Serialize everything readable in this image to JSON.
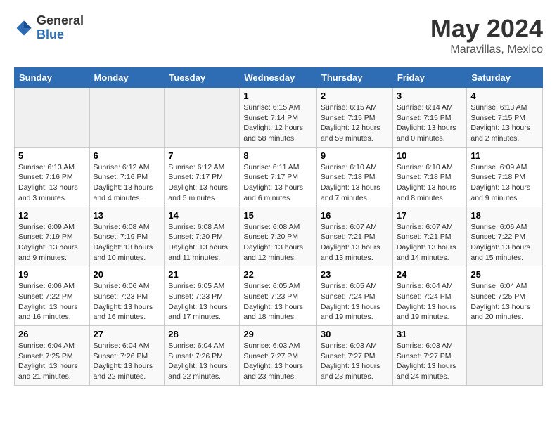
{
  "logo": {
    "general": "General",
    "blue": "Blue"
  },
  "title": {
    "month": "May 2024",
    "location": "Maravillas, Mexico"
  },
  "headers": [
    "Sunday",
    "Monday",
    "Tuesday",
    "Wednesday",
    "Thursday",
    "Friday",
    "Saturday"
  ],
  "weeks": [
    [
      {
        "day": "",
        "sunrise": "",
        "sunset": "",
        "daylight": ""
      },
      {
        "day": "",
        "sunrise": "",
        "sunset": "",
        "daylight": ""
      },
      {
        "day": "",
        "sunrise": "",
        "sunset": "",
        "daylight": ""
      },
      {
        "day": "1",
        "sunrise": "Sunrise: 6:15 AM",
        "sunset": "Sunset: 7:14 PM",
        "daylight": "Daylight: 12 hours and 58 minutes."
      },
      {
        "day": "2",
        "sunrise": "Sunrise: 6:15 AM",
        "sunset": "Sunset: 7:15 PM",
        "daylight": "Daylight: 12 hours and 59 minutes."
      },
      {
        "day": "3",
        "sunrise": "Sunrise: 6:14 AM",
        "sunset": "Sunset: 7:15 PM",
        "daylight": "Daylight: 13 hours and 0 minutes."
      },
      {
        "day": "4",
        "sunrise": "Sunrise: 6:13 AM",
        "sunset": "Sunset: 7:15 PM",
        "daylight": "Daylight: 13 hours and 2 minutes."
      }
    ],
    [
      {
        "day": "5",
        "sunrise": "Sunrise: 6:13 AM",
        "sunset": "Sunset: 7:16 PM",
        "daylight": "Daylight: 13 hours and 3 minutes."
      },
      {
        "day": "6",
        "sunrise": "Sunrise: 6:12 AM",
        "sunset": "Sunset: 7:16 PM",
        "daylight": "Daylight: 13 hours and 4 minutes."
      },
      {
        "day": "7",
        "sunrise": "Sunrise: 6:12 AM",
        "sunset": "Sunset: 7:17 PM",
        "daylight": "Daylight: 13 hours and 5 minutes."
      },
      {
        "day": "8",
        "sunrise": "Sunrise: 6:11 AM",
        "sunset": "Sunset: 7:17 PM",
        "daylight": "Daylight: 13 hours and 6 minutes."
      },
      {
        "day": "9",
        "sunrise": "Sunrise: 6:10 AM",
        "sunset": "Sunset: 7:18 PM",
        "daylight": "Daylight: 13 hours and 7 minutes."
      },
      {
        "day": "10",
        "sunrise": "Sunrise: 6:10 AM",
        "sunset": "Sunset: 7:18 PM",
        "daylight": "Daylight: 13 hours and 8 minutes."
      },
      {
        "day": "11",
        "sunrise": "Sunrise: 6:09 AM",
        "sunset": "Sunset: 7:18 PM",
        "daylight": "Daylight: 13 hours and 9 minutes."
      }
    ],
    [
      {
        "day": "12",
        "sunrise": "Sunrise: 6:09 AM",
        "sunset": "Sunset: 7:19 PM",
        "daylight": "Daylight: 13 hours and 9 minutes."
      },
      {
        "day": "13",
        "sunrise": "Sunrise: 6:08 AM",
        "sunset": "Sunset: 7:19 PM",
        "daylight": "Daylight: 13 hours and 10 minutes."
      },
      {
        "day": "14",
        "sunrise": "Sunrise: 6:08 AM",
        "sunset": "Sunset: 7:20 PM",
        "daylight": "Daylight: 13 hours and 11 minutes."
      },
      {
        "day": "15",
        "sunrise": "Sunrise: 6:08 AM",
        "sunset": "Sunset: 7:20 PM",
        "daylight": "Daylight: 13 hours and 12 minutes."
      },
      {
        "day": "16",
        "sunrise": "Sunrise: 6:07 AM",
        "sunset": "Sunset: 7:21 PM",
        "daylight": "Daylight: 13 hours and 13 minutes."
      },
      {
        "day": "17",
        "sunrise": "Sunrise: 6:07 AM",
        "sunset": "Sunset: 7:21 PM",
        "daylight": "Daylight: 13 hours and 14 minutes."
      },
      {
        "day": "18",
        "sunrise": "Sunrise: 6:06 AM",
        "sunset": "Sunset: 7:22 PM",
        "daylight": "Daylight: 13 hours and 15 minutes."
      }
    ],
    [
      {
        "day": "19",
        "sunrise": "Sunrise: 6:06 AM",
        "sunset": "Sunset: 7:22 PM",
        "daylight": "Daylight: 13 hours and 16 minutes."
      },
      {
        "day": "20",
        "sunrise": "Sunrise: 6:06 AM",
        "sunset": "Sunset: 7:23 PM",
        "daylight": "Daylight: 13 hours and 16 minutes."
      },
      {
        "day": "21",
        "sunrise": "Sunrise: 6:05 AM",
        "sunset": "Sunset: 7:23 PM",
        "daylight": "Daylight: 13 hours and 17 minutes."
      },
      {
        "day": "22",
        "sunrise": "Sunrise: 6:05 AM",
        "sunset": "Sunset: 7:23 PM",
        "daylight": "Daylight: 13 hours and 18 minutes."
      },
      {
        "day": "23",
        "sunrise": "Sunrise: 6:05 AM",
        "sunset": "Sunset: 7:24 PM",
        "daylight": "Daylight: 13 hours and 19 minutes."
      },
      {
        "day": "24",
        "sunrise": "Sunrise: 6:04 AM",
        "sunset": "Sunset: 7:24 PM",
        "daylight": "Daylight: 13 hours and 19 minutes."
      },
      {
        "day": "25",
        "sunrise": "Sunrise: 6:04 AM",
        "sunset": "Sunset: 7:25 PM",
        "daylight": "Daylight: 13 hours and 20 minutes."
      }
    ],
    [
      {
        "day": "26",
        "sunrise": "Sunrise: 6:04 AM",
        "sunset": "Sunset: 7:25 PM",
        "daylight": "Daylight: 13 hours and 21 minutes."
      },
      {
        "day": "27",
        "sunrise": "Sunrise: 6:04 AM",
        "sunset": "Sunset: 7:26 PM",
        "daylight": "Daylight: 13 hours and 22 minutes."
      },
      {
        "day": "28",
        "sunrise": "Sunrise: 6:04 AM",
        "sunset": "Sunset: 7:26 PM",
        "daylight": "Daylight: 13 hours and 22 minutes."
      },
      {
        "day": "29",
        "sunrise": "Sunrise: 6:03 AM",
        "sunset": "Sunset: 7:27 PM",
        "daylight": "Daylight: 13 hours and 23 minutes."
      },
      {
        "day": "30",
        "sunrise": "Sunrise: 6:03 AM",
        "sunset": "Sunset: 7:27 PM",
        "daylight": "Daylight: 13 hours and 23 minutes."
      },
      {
        "day": "31",
        "sunrise": "Sunrise: 6:03 AM",
        "sunset": "Sunset: 7:27 PM",
        "daylight": "Daylight: 13 hours and 24 minutes."
      },
      {
        "day": "",
        "sunrise": "",
        "sunset": "",
        "daylight": ""
      }
    ]
  ]
}
